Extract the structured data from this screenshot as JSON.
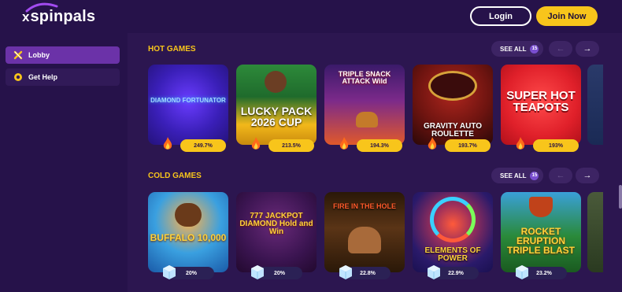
{
  "header": {
    "logo_text": "spinpals",
    "logo_x": "x",
    "login_label": "Login",
    "join_label": "Join Now"
  },
  "sidebar": {
    "items": [
      {
        "label": "Lobby",
        "icon": "lobby-icon"
      },
      {
        "label": "Get Help",
        "icon": "help-icon"
      }
    ]
  },
  "sections": [
    {
      "title": "HOT GAMES",
      "see_all": "SEE ALL",
      "count": "15",
      "games": [
        {
          "title": "DIAMOND FORTUNATOR",
          "value": "249.7%"
        },
        {
          "title": "LUCKY PACK 2026 CUP",
          "value": "213.5%"
        },
        {
          "title": "TRIPLE SNACK ATTACK Wild",
          "value": "194.3%"
        },
        {
          "title": "GRAVITY AUTO ROULETTE",
          "value": "193.7%"
        },
        {
          "title": "SUPER HOT TEAPOTS",
          "value": "193%"
        }
      ]
    },
    {
      "title": "COLD GAMES",
      "see_all": "SEE ALL",
      "count": "15",
      "games": [
        {
          "title": "BUFFALO 10,000",
          "value": "20%"
        },
        {
          "title": "777 JACKPOT DIAMOND Hold and Win",
          "value": "20%"
        },
        {
          "title": "FIRE IN THE HOLE",
          "value": "22.8%"
        },
        {
          "title": "ELEMENTS OF POWER",
          "value": "22.9%"
        },
        {
          "title": "ROCKET ERUPTION TRIPLE BLAST",
          "value": "23.2%"
        }
      ]
    }
  ],
  "colors": {
    "background": "#2c1650",
    "accent": "#f8c51b",
    "active": "#6b32a8"
  }
}
